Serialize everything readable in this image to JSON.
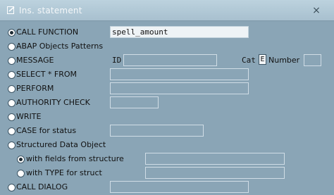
{
  "window": {
    "title": "Ins. statement",
    "title_icon": "edit-icon",
    "close_label": "×"
  },
  "options": {
    "call_function": {
      "label": "CALL FUNCTION",
      "value": "spell_amount",
      "selected": true
    },
    "abap_objects": {
      "label": "ABAP Objects Patterns"
    },
    "message": {
      "label": "MESSAGE",
      "id_label": "ID",
      "id_value": "",
      "cat_label": "Cat",
      "cat_value": "E",
      "number_label": "Number",
      "number_value": ""
    },
    "select_from": {
      "label": "SELECT * FROM",
      "value": ""
    },
    "perform": {
      "label": "PERFORM",
      "value": ""
    },
    "authority_check": {
      "label": "AUTHORITY CHECK",
      "value": ""
    },
    "write": {
      "label": "WRITE"
    },
    "case_for_status": {
      "label": "CASE for status",
      "value": ""
    },
    "structured_data_object": {
      "label": "Structured Data Object"
    },
    "with_fields_from_structure": {
      "label": "with fields from structure",
      "value": "",
      "selected": true
    },
    "with_type_for_struct": {
      "label": "with TYPE for struct",
      "value": ""
    },
    "call_dialog": {
      "label": "CALL DIALOG",
      "value": ""
    }
  }
}
